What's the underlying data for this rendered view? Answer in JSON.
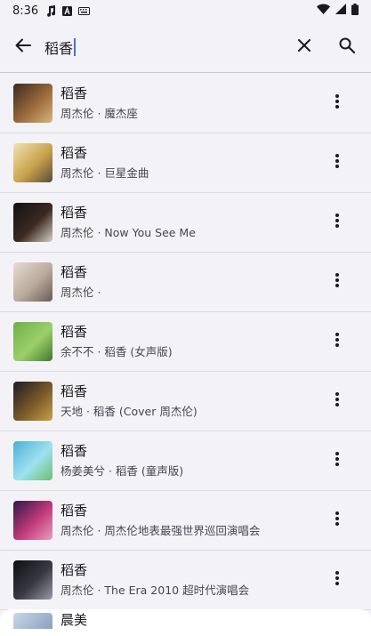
{
  "status_bar": {
    "time": "8:36",
    "icons": [
      "music-note-icon",
      "text-a-icon",
      "keyboard-icon"
    ],
    "right_icons": [
      "wifi-icon",
      "signal-icon",
      "battery-icon"
    ]
  },
  "search": {
    "query": "稻香",
    "back_icon": "arrow-left-icon",
    "clear_icon": "close-icon",
    "search_icon": "search-icon"
  },
  "results": [
    {
      "title": "稻香",
      "subtitle": "周杰伦 · 魔杰座",
      "thumb_colors": [
        "#3a2a20",
        "#9b6a3c",
        "#d9b47a"
      ]
    },
    {
      "title": "稻香",
      "subtitle": "周杰伦 · 巨星金曲",
      "thumb_colors": [
        "#f1e2b8",
        "#c9a24a",
        "#5a4a3a"
      ]
    },
    {
      "title": "稻香",
      "subtitle": "周杰伦 · Now You See Me",
      "thumb_colors": [
        "#111111",
        "#3b2a22",
        "#d8cfc3"
      ]
    },
    {
      "title": "稻香",
      "subtitle": "周杰伦 · ",
      "thumb_colors": [
        "#e8dcd2",
        "#b9a99b",
        "#6b5a55"
      ]
    },
    {
      "title": "稻香",
      "subtitle": "余不不 · 稻香 (女声版)",
      "thumb_colors": [
        "#6fae4a",
        "#9ccf6a",
        "#3f7a2c"
      ]
    },
    {
      "title": "稻香",
      "subtitle": "天地 · 稻香 (Cover 周杰伦)",
      "thumb_colors": [
        "#1c1c22",
        "#7a5a2a",
        "#c9a04a"
      ]
    },
    {
      "title": "稻香",
      "subtitle": "杨姜美兮 · 稻香 (童声版)",
      "thumb_colors": [
        "#4ab0d8",
        "#9fe0f0",
        "#6cbf6a"
      ]
    },
    {
      "title": "稻香",
      "subtitle": "周杰伦 · 周杰伦地表最强世界巡回演唱会",
      "thumb_colors": [
        "#2a1a4a",
        "#c23a7a",
        "#e8a0c0"
      ]
    },
    {
      "title": "稻香",
      "subtitle": "周杰伦 · The Era 2010 超时代演唱会",
      "thumb_colors": [
        "#0e0e12",
        "#3a3a44",
        "#9a9aa8"
      ]
    }
  ],
  "partial_result": {
    "title": "晨美",
    "thumb_colors": [
      "#c9d6e8",
      "#8aa0c0"
    ]
  }
}
